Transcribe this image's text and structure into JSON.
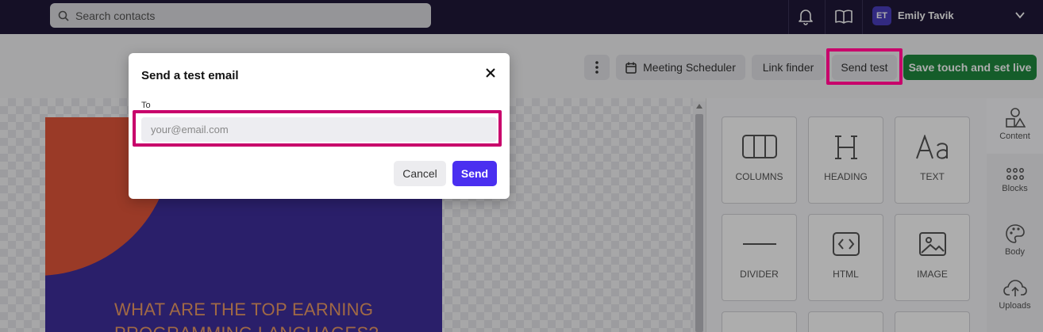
{
  "topbar": {
    "search_placeholder": "Search contacts",
    "icons": [
      "bell-icon",
      "book-icon"
    ],
    "user": {
      "initials": "ET",
      "name": "Emily Tavik"
    }
  },
  "toolbar": {
    "meeting_label": "Meeting Scheduler",
    "link_finder_label": "Link finder",
    "send_test_label": "Send test",
    "save_label": "Save touch and set live"
  },
  "email_preview": {
    "headline": "WHAT ARE THE TOP EARNING PROGRAMMING LANGUAGES?"
  },
  "content_tiles": [
    {
      "label": "COLUMNS",
      "icon": "columns-icon"
    },
    {
      "label": "HEADING",
      "icon": "heading-icon"
    },
    {
      "label": "TEXT",
      "icon": "text-icon"
    },
    {
      "label": "DIVIDER",
      "icon": "divider-icon"
    },
    {
      "label": "HTML",
      "icon": "html-icon"
    },
    {
      "label": "IMAGE",
      "icon": "image-icon"
    }
  ],
  "sidebar": {
    "items": [
      {
        "label": "Content",
        "icon": "shapes-icon"
      },
      {
        "label": "Blocks",
        "icon": "grid-icon"
      },
      {
        "label": "Body",
        "icon": "palette-icon"
      },
      {
        "label": "Uploads",
        "icon": "upload-cloud-icon"
      }
    ]
  },
  "modal": {
    "title": "Send a test email",
    "to_label": "To",
    "to_placeholder": "your@email.com",
    "to_value": "",
    "cancel_label": "Cancel",
    "send_label": "Send"
  },
  "colors": {
    "topbar_bg": "#1f1838",
    "save_button": "#1f8a3f",
    "send_button": "#4a2ff0",
    "highlight": "#c8006b",
    "email_bg": "#3f2e9c",
    "email_accent": "#e4563a"
  }
}
